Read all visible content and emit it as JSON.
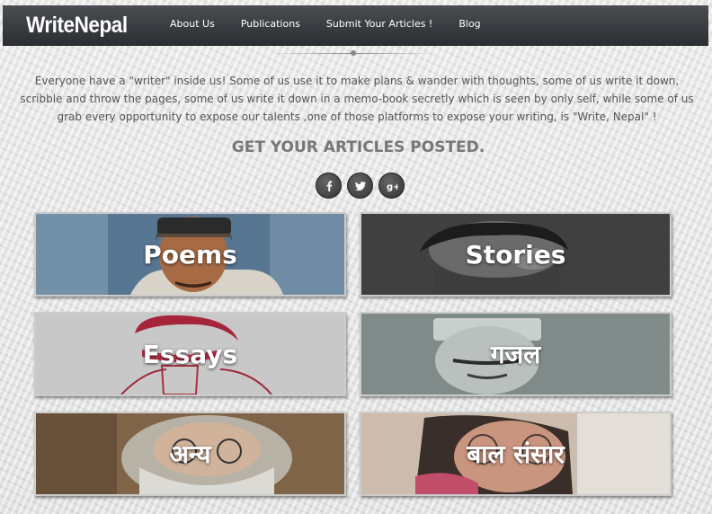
{
  "brand": "WriteNepal",
  "nav": [
    "About Us",
    "Publications",
    "Submit Your Articles !",
    "Blog"
  ],
  "intro": "Everyone have a \"writer\" inside us! Some of us use it to make plans & wander with thoughts, some of us write it down, scribble and throw the pages, some of us write it down in a memo-book secretly which is seen by only self, while some of us grab every opportunity to expose our talents ,one of those platforms to expose your writing, is \"Write, Nepal\" !",
  "cta": "GET YOUR ARTICLES POSTED.",
  "social": [
    {
      "icon": "facebook-icon"
    },
    {
      "icon": "twitter-icon"
    },
    {
      "icon": "google-plus-icon"
    }
  ],
  "tiles": [
    {
      "label": "Poems",
      "image": "portrait-man-cap-painting"
    },
    {
      "label": "Stories",
      "image": "portrait-man-black-white"
    },
    {
      "label": "Essays",
      "image": "portrait-man-red-sketch"
    },
    {
      "label": "गजल",
      "image": "portrait-man-hat-sketch"
    },
    {
      "label": "अन्य",
      "image": "portrait-old-man-beard"
    },
    {
      "label": "बाल संसार",
      "image": "portrait-woman-glasses"
    }
  ]
}
